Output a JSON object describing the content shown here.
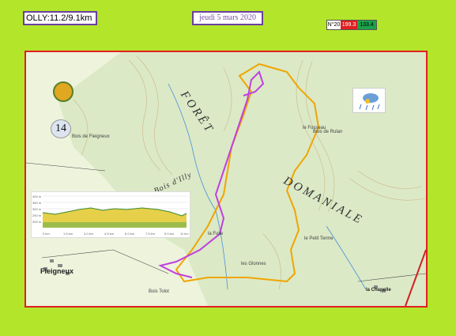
{
  "header": {
    "title": "OLLY:11.2/9.1km",
    "date": "jeudi 5 mars 2020"
  },
  "badges": {
    "number": "N°20",
    "red_value": "199.3",
    "green_value": "133.4",
    "red_color": "#e02020",
    "green_color": "#1aa34a"
  },
  "map": {
    "marker_number": "14",
    "forest_name_line1": "FORÊT",
    "forest_name_line2": "DOMANIALE",
    "bois_illy": "Bois d'Illy",
    "town_left": "Fleigneux",
    "town_right": "la Chapelle",
    "labels": [
      "Bois de Fleigneux",
      "Bois de Rulan",
      "le Petit Terme",
      "le Fosseau",
      "les Glonnes",
      "Bois Tolot",
      "la Fulie"
    ],
    "route_colors": {
      "short": "#c040e0",
      "long": "#f0a500"
    }
  },
  "profile": {
    "y_ticks": [
      "400 m",
      "350 m",
      "300 m",
      "250 m",
      "200 m"
    ],
    "x_ticks": [
      "0 km",
      "1.5 km",
      "3.0 km",
      "4.5 km",
      "6.0 km",
      "7.5 km",
      "9.0 km",
      "11 km"
    ]
  }
}
